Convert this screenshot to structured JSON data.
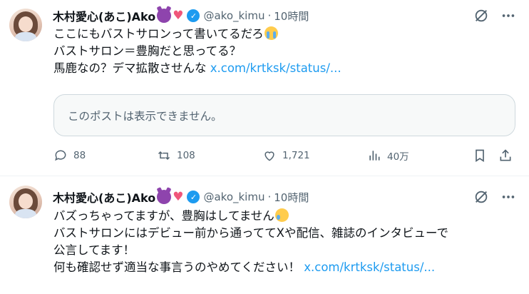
{
  "tweets": [
    {
      "author": {
        "name": "木村愛心(あこ)Ako",
        "handle": "@ako_kimu",
        "separator": "·",
        "time": "10時間"
      },
      "lines": [
        "ここにもバストサロンって書いてるだろ",
        "バストサロン＝豊胸だと思ってる？",
        "馬鹿なの？デマ拡散させんな "
      ],
      "link": "x.com/krtksk/status/...",
      "quote_unavailable": "このポストは表示できません。",
      "stats": {
        "replies": "88",
        "reposts": "108",
        "likes": "1,721",
        "views": "40万"
      }
    },
    {
      "author": {
        "name": "木村愛心(あこ)Ako",
        "handle": "@ako_kimu",
        "separator": "·",
        "time": "10時間"
      },
      "lines": [
        "バズっちゃってますが、豊胸はしてません",
        "バストサロンにはデビュー前から通っててXや配信、雑誌のインタビューで",
        "公言してます！",
        "何も確認せず適当な事言うのやめてください！ "
      ],
      "link": "x.com/krtksk/status/..."
    }
  ],
  "colors": {
    "accent": "#1d9bf0",
    "secondary_text": "#536471",
    "border": "#cfd9de",
    "quote_bg": "#f7f9f9"
  },
  "icons": {
    "reply": "reply-icon",
    "repost": "repost-icon",
    "like": "heart-icon",
    "views": "views-icon",
    "bookmark": "bookmark-icon",
    "share": "share-icon",
    "grok": "grok-icon",
    "more": "more-icon",
    "verified": "verified-badge-icon"
  }
}
